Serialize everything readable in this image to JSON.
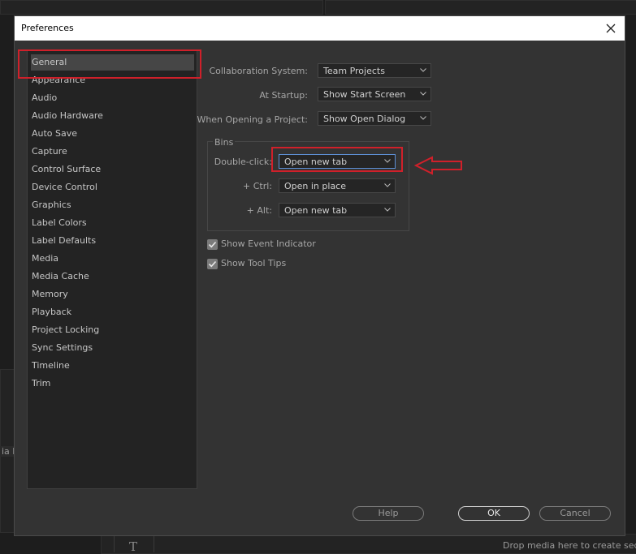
{
  "dialog": {
    "title": "Preferences"
  },
  "sidebar": {
    "items": [
      {
        "label": "General",
        "selected": true
      },
      {
        "label": "Appearance"
      },
      {
        "label": "Audio"
      },
      {
        "label": "Audio Hardware"
      },
      {
        "label": "Auto Save"
      },
      {
        "label": "Capture"
      },
      {
        "label": "Control Surface"
      },
      {
        "label": "Device Control"
      },
      {
        "label": "Graphics"
      },
      {
        "label": "Label Colors"
      },
      {
        "label": "Label Defaults"
      },
      {
        "label": "Media"
      },
      {
        "label": "Media Cache"
      },
      {
        "label": "Memory"
      },
      {
        "label": "Playback"
      },
      {
        "label": "Project Locking"
      },
      {
        "label": "Sync Settings"
      },
      {
        "label": "Timeline"
      },
      {
        "label": "Trim"
      }
    ]
  },
  "general": {
    "collab_label": "Collaboration System:",
    "collab_value": "Team Projects",
    "startup_label": "At Startup:",
    "startup_value": "Show Start Screen",
    "opening_label": "When Opening a Project:",
    "opening_value": "Show Open Dialog"
  },
  "bins": {
    "title": "Bins",
    "double_click_label": "Double-click:",
    "double_click_value": "Open new tab",
    "ctrl_label": "+ Ctrl:",
    "ctrl_value": "Open in place",
    "alt_label": "+ Alt:",
    "alt_value": "Open new tab"
  },
  "checkboxes": {
    "event_indicator": {
      "label": "Show Event Indicator",
      "checked": true
    },
    "tool_tips": {
      "label": "Show Tool Tips",
      "checked": true
    }
  },
  "buttons": {
    "help": "Help",
    "ok": "OK",
    "cancel": "Cancel"
  },
  "background": {
    "drop_hint": "Drop media here to create seque",
    "side_fragment": "ia B",
    "tool_glyph": "T"
  },
  "annotation_color": "#d0202a"
}
